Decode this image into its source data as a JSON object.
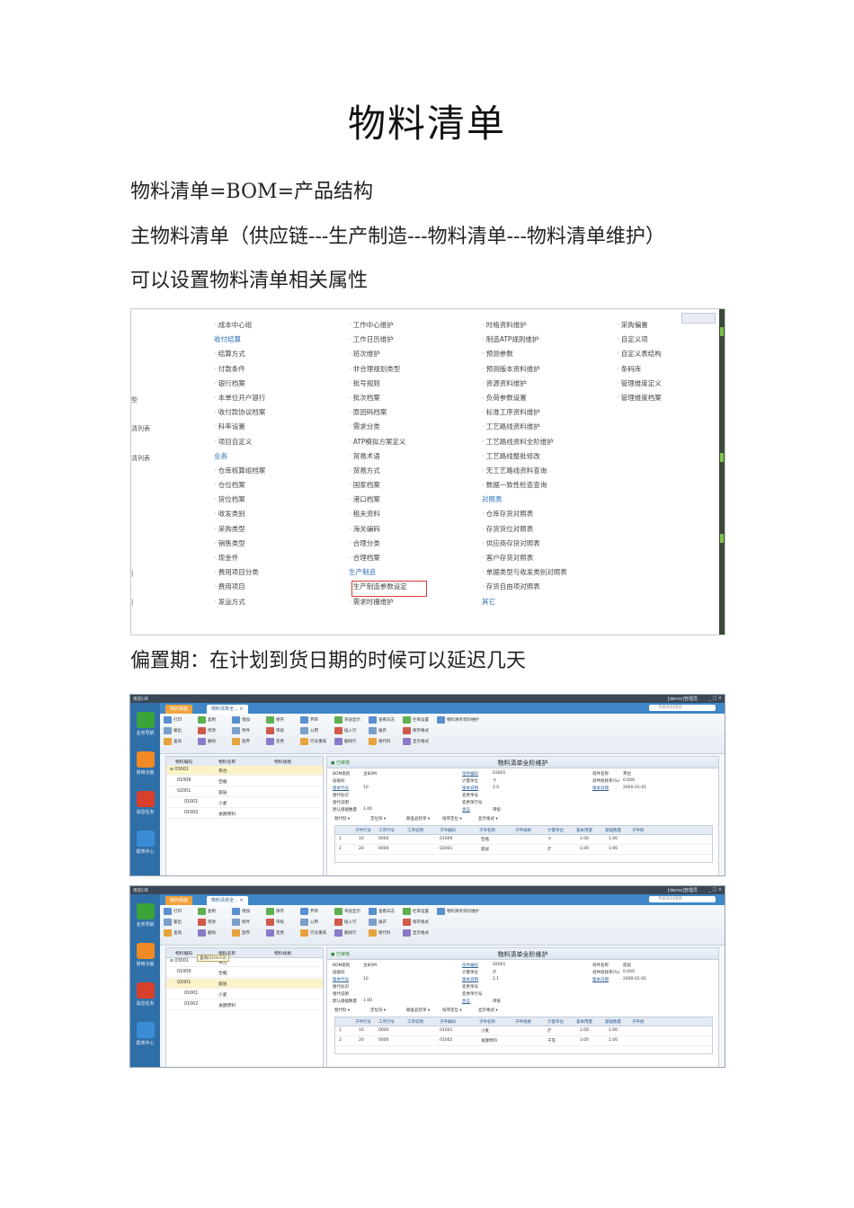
{
  "title": "物料清单",
  "paragraphs": [
    "物料清单=BOM=产品结构",
    "主物料清单（供应链---生产制造---物料清单---物料清单维护）",
    "可以设置物料清单相关属性",
    "偏置期：在计划到货日期的时候可以延迟几天"
  ],
  "menu": {
    "edge_labels": [
      "型",
      "清列表",
      "清列表",
      "|",
      "|"
    ],
    "col1": [
      {
        "t": "成本中心组",
        "k": "b"
      },
      {
        "t": "收付结算",
        "k": "h"
      },
      {
        "t": "结算方式",
        "k": "b"
      },
      {
        "t": "付款条件",
        "k": "b"
      },
      {
        "t": "银行档案",
        "k": "b"
      },
      {
        "t": "本单位开户银行",
        "k": "b"
      },
      {
        "t": "收付款协议档案",
        "k": "b"
      },
      {
        "t": "科率设置",
        "k": "b"
      },
      {
        "t": "项目自定义",
        "k": "b"
      },
      {
        "t": "业务",
        "k": "h"
      },
      {
        "t": "仓库核算组档案",
        "k": "b"
      },
      {
        "t": "仓位档案",
        "k": "b"
      },
      {
        "t": "货位档案",
        "k": "b"
      },
      {
        "t": "收发类别",
        "k": "b"
      },
      {
        "t": "采购类型",
        "k": "b"
      },
      {
        "t": "销售类型",
        "k": "b"
      },
      {
        "t": "现金件",
        "k": "b"
      },
      {
        "t": "费用项目分类",
        "k": "b"
      },
      {
        "t": "费用项目",
        "k": "b"
      },
      {
        "t": "发运方式",
        "k": "b"
      }
    ],
    "col2": [
      {
        "t": "工作中心维护",
        "k": "b"
      },
      {
        "t": "工作日历维护",
        "k": "b"
      },
      {
        "t": "班次维护",
        "k": "b"
      },
      {
        "t": "非合理规划类型",
        "k": "b"
      },
      {
        "t": "批号规则",
        "k": "b"
      },
      {
        "t": "批次档案",
        "k": "b"
      },
      {
        "t": "原因码档案",
        "k": "b"
      },
      {
        "t": "需求分类",
        "k": "b"
      },
      {
        "t": "ATP模拟方案定义",
        "k": "b"
      },
      {
        "t": "贸易术语",
        "k": "b"
      },
      {
        "t": "贸易方式",
        "k": "b"
      },
      {
        "t": "国家档案",
        "k": "b"
      },
      {
        "t": "港口档案",
        "k": "b"
      },
      {
        "t": "租夫资料",
        "k": "b"
      },
      {
        "t": "海关编码",
        "k": "b"
      },
      {
        "t": "合理分类",
        "k": "b"
      },
      {
        "t": "合理档案",
        "k": "b"
      },
      {
        "t": "生产制造",
        "k": "h"
      },
      {
        "t": "生产制造参数设定",
        "k": "b"
      },
      {
        "t": "需求时栅维护",
        "k": "b"
      }
    ],
    "col3": [
      {
        "t": "时格资料维护",
        "k": "b"
      },
      {
        "t": "制造ATP规则维护",
        "k": "b"
      },
      {
        "t": "预测参数",
        "k": "b"
      },
      {
        "t": "预测版本资料维护",
        "k": "b"
      },
      {
        "t": "资源资料维护",
        "k": "b"
      },
      {
        "t": "负荷参数设置",
        "k": "b"
      },
      {
        "t": "标准工序资料维护",
        "k": "b"
      },
      {
        "t": "工艺路线资料维护",
        "k": "b"
      },
      {
        "t": "工艺路线资料全阶维护",
        "k": "b"
      },
      {
        "t": "工艺路线整批修改",
        "k": "b"
      },
      {
        "t": "无工艺路线资料查询",
        "k": "b"
      },
      {
        "t": "数据一致性检查查询",
        "k": "b"
      },
      {
        "t": "对照表",
        "k": "h"
      },
      {
        "t": "仓库存货对照表",
        "k": "b"
      },
      {
        "t": "存货货位对照表",
        "k": "b"
      },
      {
        "t": "供应商存货对照表",
        "k": "b"
      },
      {
        "t": "客户存货对照表",
        "k": "b"
      },
      {
        "t": "单据类型与收发类别对照表",
        "k": "b"
      },
      {
        "t": "存货自由项对照表",
        "k": "b"
      },
      {
        "t": "其它",
        "k": "h"
      }
    ],
    "col4": [
      {
        "t": "采购偏置",
        "k": "b"
      },
      {
        "t": "自定义项",
        "k": "b"
      },
      {
        "t": "自定义表结构",
        "k": "b"
      },
      {
        "t": "条码库",
        "k": "b"
      },
      {
        "t": "管理维度定义",
        "k": "b"
      },
      {
        "t": "管理维度档案",
        "k": "b"
      }
    ]
  },
  "app": {
    "brand": "用友U8",
    "user_info": "[demo]管理员",
    "tabs": [
      "我的桌面",
      "物料清单全..."
    ],
    "search_placeholder": "单据条码搜索",
    "nav": [
      "业务导航",
      "常用功能",
      "消息任务",
      "报表中心"
    ],
    "toolbar": [
      "打印",
      "输出",
      "查询",
      "复制",
      "修改",
      "删除",
      "增加",
      "附件",
      "放弃",
      "保存",
      "审核",
      "变更",
      "弃审",
      "公用",
      "行号重排",
      "单层显示",
      "插入行",
      "删除行",
      "查看日志",
      "展开",
      "替代料",
      "栏目设置",
      "保存格式",
      "显示格式",
      "物料清单资料维护"
    ],
    "tree_headers": [
      "物料编码",
      "物料名称",
      "物料规格"
    ],
    "form_title": "物料清单全阶维护",
    "grid_toolbar": [
      "替代料",
      "定位符",
      "联查品检单",
      "排序定位",
      "显示格式"
    ],
    "grid_headers": [
      "",
      "子件行号",
      "工序行号",
      "工序说明",
      "子件编码",
      "子件名称",
      "子件规格",
      "计量单位",
      "基本用量",
      "基础数量",
      "子件损"
    ],
    "shot2": {
      "status": "已审核",
      "tree": [
        {
          "code": "03001",
          "name": "茶台",
          "indent": 0,
          "sel": true
        },
        {
          "code": "01009",
          "name": "空瓶",
          "indent": 1
        },
        {
          "code": "02001",
          "name": "座层",
          "indent": 1
        },
        {
          "code": "01001",
          "name": "小麦",
          "indent": 2
        },
        {
          "code": "01002",
          "name": "发酵原料",
          "indent": 2
        }
      ],
      "fields": {
        "bom_type": "主BOM",
        "parent_code": "03001",
        "parent_name": "茶台",
        "version_no": "10",
        "unit": "个",
        "scrap_rate": "0.000",
        "version_desc": "1.0",
        "version_date": "2000-01-01",
        "status": "审核",
        "base_qty": "1.00"
      },
      "rows": [
        {
          "n": "1",
          "seq": "10",
          "op": "0000",
          "code": "01009",
          "name": "空瓶",
          "unit": "个",
          "qty": "1.00",
          "base": "1.00"
        },
        {
          "n": "2",
          "seq": "20",
          "op": "0000",
          "code": "02001",
          "name": "座层",
          "unit": "斤",
          "qty": "1.00",
          "base": "1.00"
        }
      ]
    },
    "shot3": {
      "status": "已审核",
      "tooltip": "查询(Ctrl+F3)",
      "tree": [
        {
          "code": "03001",
          "name": "茶台",
          "indent": 0
        },
        {
          "code": "01009",
          "name": "空瓶",
          "indent": 1
        },
        {
          "code": "02001",
          "name": "座层",
          "indent": 1,
          "sel": true
        },
        {
          "code": "01001",
          "name": "小麦",
          "indent": 2
        },
        {
          "code": "01002",
          "name": "发酵原料",
          "indent": 2
        }
      ],
      "fields": {
        "bom_type": "主BOM",
        "parent_code": "02001",
        "parent_name": "座层",
        "version_no": "10",
        "unit": "斤",
        "scrap_rate": "0.000",
        "version_desc": "1.1",
        "version_date": "2000-01-01",
        "status": "审核",
        "base_qty": "1.00"
      },
      "rows": [
        {
          "n": "1",
          "seq": "10",
          "op": "0000",
          "code": "01001",
          "name": "小麦",
          "unit": "斤",
          "qty": "2.00",
          "base": "1.00"
        },
        {
          "n": "2",
          "seq": "20",
          "op": "0000",
          "code": "01002",
          "name": "发酵原料",
          "unit": "千克",
          "qty": "3.00",
          "base": "1.00"
        }
      ]
    },
    "labels": {
      "bom_type": "BOM类别",
      "parent_code": "母件编码",
      "parent_name": "母件名称",
      "version_no": "版本代号",
      "unit": "计量单位",
      "scrap_rate": "母件损耗率(%)",
      "version_desc": "版本说明",
      "version_date": "版本日期",
      "status": "状态",
      "base_qty": "默认基础数量",
      "seq_code": "层级码",
      "sub_plan": "替代标识",
      "sub_desc": "替代说明",
      "change_no": "变更单号",
      "change_seq": "变更单行号"
    }
  }
}
